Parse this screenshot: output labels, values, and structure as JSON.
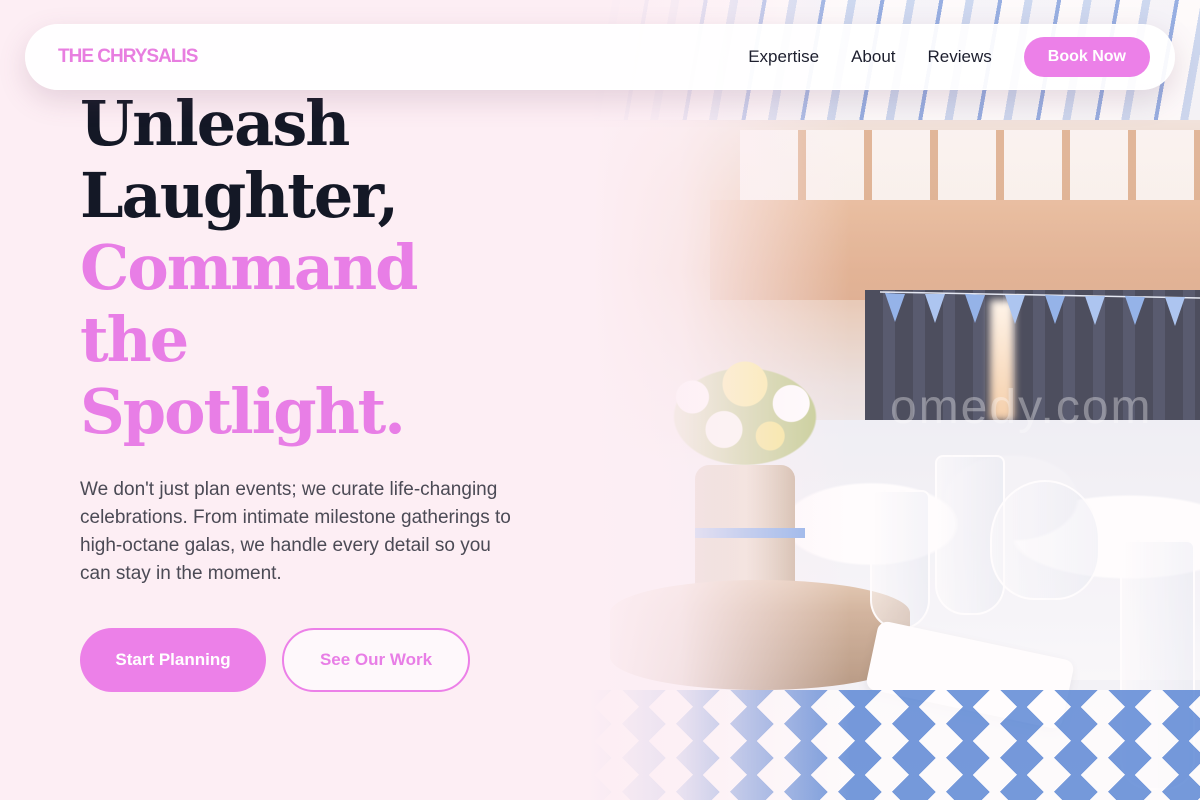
{
  "brand": {
    "logo": "THE CHRYSALIS"
  },
  "nav": {
    "links": [
      "Expertise",
      "About",
      "Reviews"
    ],
    "cta": "Book Now"
  },
  "hero": {
    "headline_dark": [
      "Unleash",
      "Laughter,"
    ],
    "headline_accent": [
      "Command",
      "the",
      "Spotlight."
    ],
    "description": "We don't just plan events; we curate life-changing celebrations. From intimate milestone gatherings to high-octane galas, we handle every detail so you can stay in the moment.",
    "primary_cta": "Start Planning",
    "secondary_cta": "See Our Work"
  },
  "image": {
    "watermark": "omedy.com",
    "subject": "decorated banquet hall with flowers and glassware"
  },
  "colors": {
    "accent": "#ec80e8",
    "accent_text": "#e87ee6",
    "heading_dark": "#141826",
    "background": "#fdeef4"
  }
}
